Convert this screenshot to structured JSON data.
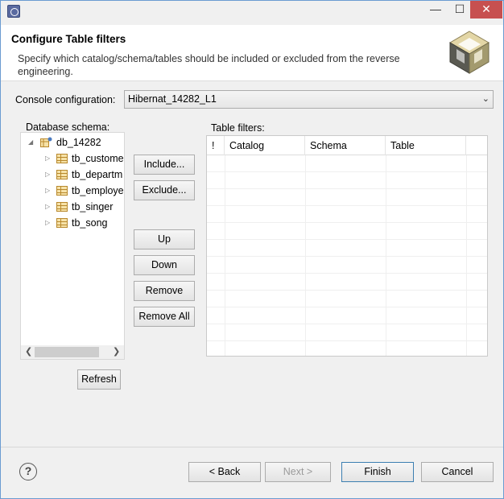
{
  "window": {
    "controls": {
      "minimize": "—",
      "maximize": "☐",
      "close": "✕"
    }
  },
  "header": {
    "title": "Configure Table filters",
    "description": "Specify which catalog/schema/tables should be included or excluded from the reverse engineering.",
    "logo_icon": "hibernate-cube-icon"
  },
  "console": {
    "label": "Console configuration:",
    "value": "Hibernat_14282_L1"
  },
  "schema_tree": {
    "label": "Database schema:",
    "root": {
      "label": "db_14282",
      "expanded": true
    },
    "tables": [
      "tb_custome",
      "tb_departm",
      "tb_employe",
      "tb_singer",
      "tb_song"
    ]
  },
  "actions": {
    "include": "Include...",
    "exclude": "Exclude...",
    "up": "Up",
    "down": "Down",
    "remove": "Remove",
    "remove_all": "Remove All",
    "refresh": "Refresh"
  },
  "table_filters": {
    "label": "Table filters:",
    "columns": [
      "!",
      "Catalog",
      "Schema",
      "Table"
    ],
    "rows": []
  },
  "footer": {
    "help": "?",
    "back": "< Back",
    "next": "Next >",
    "finish": "Finish",
    "cancel": "Cancel"
  }
}
